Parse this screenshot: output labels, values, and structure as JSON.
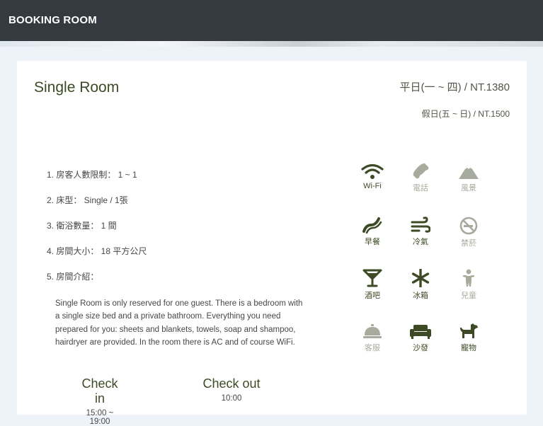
{
  "header": {
    "brand": "BOOKING ROOM"
  },
  "room": {
    "title": "Single Room",
    "price_weekday": "平日(一 ~ 四) / NT.1380",
    "price_weekend": "假日(五 ~ 日) / NT.1500"
  },
  "info": [
    "1. 房客人數限制： 1 ~ 1",
    "2. 床型： Single / 1張",
    "3. 衛浴數量： 1 間",
    "4. 房間大小： 18 平方公尺",
    "5. 房間介紹："
  ],
  "description": "Single Room is only reserved for one guest. There is a bedroom with a single size bed and a private bathroom. Everything you need prepared for you: sheets and blankets, towels, soap and shampoo, hairdryer are provided. In the room there is AC and of course WiFi.",
  "checkin": {
    "label": "Check in",
    "time": "15:00 ~ 19:00"
  },
  "checkout": {
    "label": "Check out",
    "time": "10:00"
  },
  "amenities": [
    {
      "label": "Wi-Fi",
      "icon": "wifi-icon",
      "available": true
    },
    {
      "label": "電話",
      "icon": "phone-icon",
      "available": false
    },
    {
      "label": "風景",
      "icon": "mountain-icon",
      "available": false
    },
    {
      "label": "早餐",
      "icon": "breakfast-icon",
      "available": true
    },
    {
      "label": "冷氣",
      "icon": "wind-icon",
      "available": true
    },
    {
      "label": "禁菸",
      "icon": "no-smoking-icon",
      "available": false
    },
    {
      "label": "酒吧",
      "icon": "cocktail-icon",
      "available": true
    },
    {
      "label": "冰箱",
      "icon": "snowflake-icon",
      "available": true
    },
    {
      "label": "兒童",
      "icon": "child-icon",
      "available": false
    },
    {
      "label": "客服",
      "icon": "service-bell-icon",
      "available": false
    },
    {
      "label": "沙發",
      "icon": "sofa-icon",
      "available": true
    },
    {
      "label": "寵物",
      "icon": "dog-icon",
      "available": true
    }
  ],
  "colors": {
    "available": "#3e4a25",
    "unavailable": "#a7ab9d",
    "header_bg": "#353a40"
  }
}
